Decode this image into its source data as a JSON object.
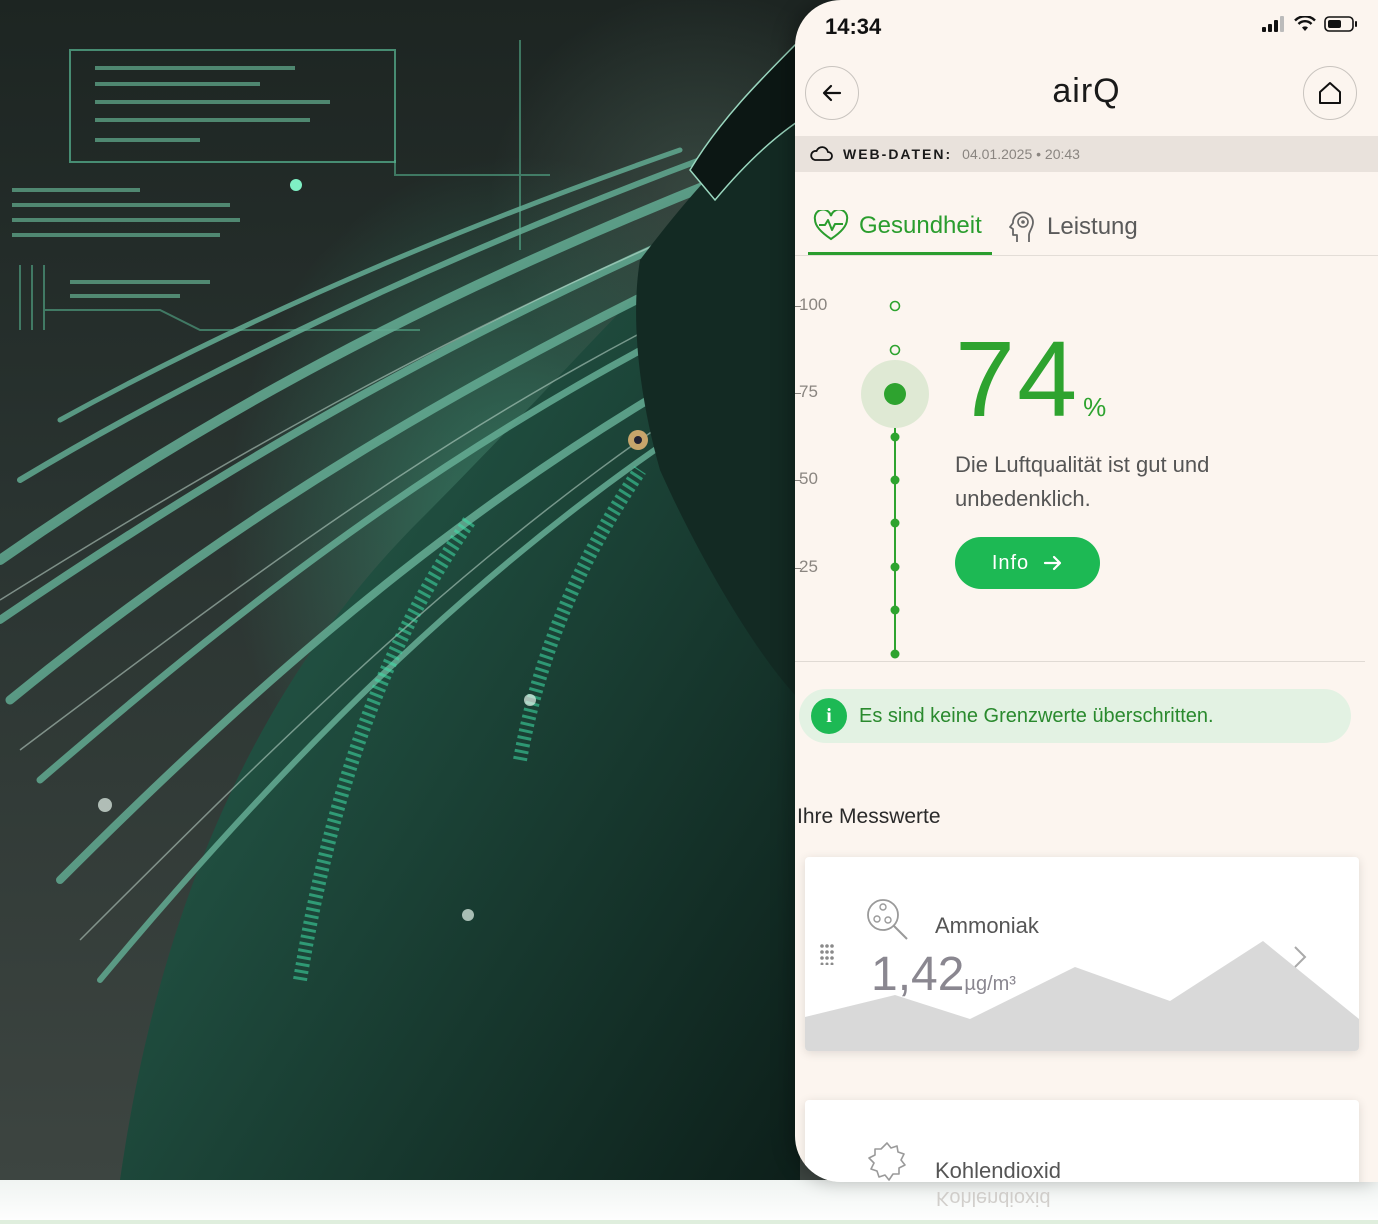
{
  "status_bar": {
    "time": "14:34"
  },
  "header": {
    "title": "airQ"
  },
  "web_data": {
    "label": "WEB-DATEN:",
    "date": "04.01.2025 • 20:43"
  },
  "tabs": [
    {
      "label": "Gesundheit",
      "active": true
    },
    {
      "label": "Leistung",
      "active": false
    }
  ],
  "scale": {
    "labels": [
      "100",
      "75",
      "50",
      "25"
    ],
    "value_percent": 74
  },
  "score": {
    "value": "74",
    "unit": "%",
    "description": "Die Luftqualität ist gut und unbedenklich.",
    "info_label": "Info"
  },
  "notice": {
    "icon": "i",
    "text": "Es sind keine Grenzwerte überschritten."
  },
  "measurements": {
    "title": "Ihre Messwerte",
    "items": [
      {
        "name": "Ammoniak",
        "value": "1,42",
        "unit": "µg/m³",
        "icon": "molecule-search-icon"
      },
      {
        "name": "Kohlendioxid",
        "icon": "co2-cloud-icon"
      }
    ]
  },
  "colors": {
    "accent": "#2ea32f",
    "button": "#1db954",
    "notice_bg": "#e3f2e3",
    "phone_bg": "#fcf5ef"
  },
  "reflection_text": "Kohlendioxid"
}
